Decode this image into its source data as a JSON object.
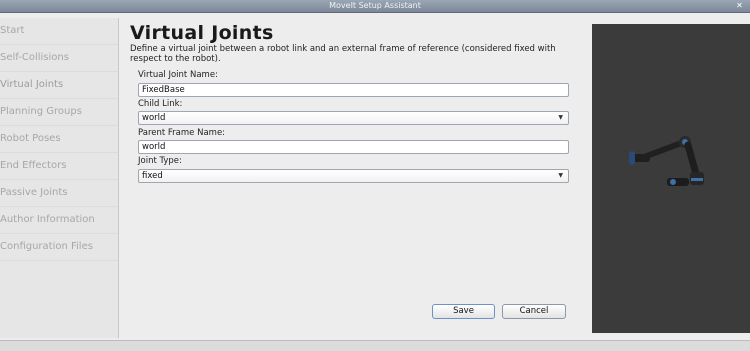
{
  "window": {
    "title": "MoveIt Setup Assistant"
  },
  "sidebar": {
    "items": [
      {
        "label": "Start"
      },
      {
        "label": "Self-Collisions"
      },
      {
        "label": "Virtual Joints"
      },
      {
        "label": "Planning Groups"
      },
      {
        "label": "Robot Poses"
      },
      {
        "label": "End Effectors"
      },
      {
        "label": "Passive Joints"
      },
      {
        "label": "Author Information"
      },
      {
        "label": "Configuration Files"
      }
    ]
  },
  "main": {
    "title": "Virtual Joints",
    "description": "Define a virtual joint between a robot link and an external frame of reference (considered fixed with respect to the robot).",
    "form": {
      "name_label": "Virtual Joint Name:",
      "name_value": "FixedBase",
      "child_label": "Child Link:",
      "child_value": "world",
      "parent_label": "Parent Frame Name:",
      "parent_value": "world",
      "type_label": "Joint Type:",
      "type_value": "fixed"
    },
    "buttons": {
      "save": "Save",
      "cancel": "Cancel"
    }
  },
  "viewer": {
    "model_icon": "robot-arm-icon"
  }
}
